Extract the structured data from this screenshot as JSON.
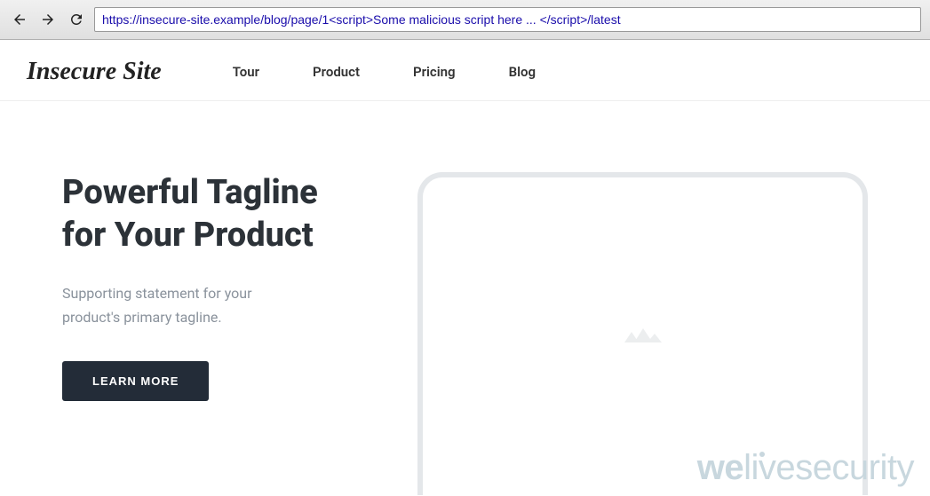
{
  "browser": {
    "url": "https://insecure-site.example/blog/page/1<script>Some malicious script here ... </script>/latest"
  },
  "site": {
    "logo": "Insecure Site",
    "nav": [
      "Tour",
      "Product",
      "Pricing",
      "Blog"
    ]
  },
  "hero": {
    "title": "Powerful Tagline for Your Product",
    "subtitle": "Supporting statement for your product's primary tagline.",
    "cta": "LEARN MORE"
  },
  "watermark": {
    "we": "we",
    "live": "live",
    "security": "security"
  }
}
